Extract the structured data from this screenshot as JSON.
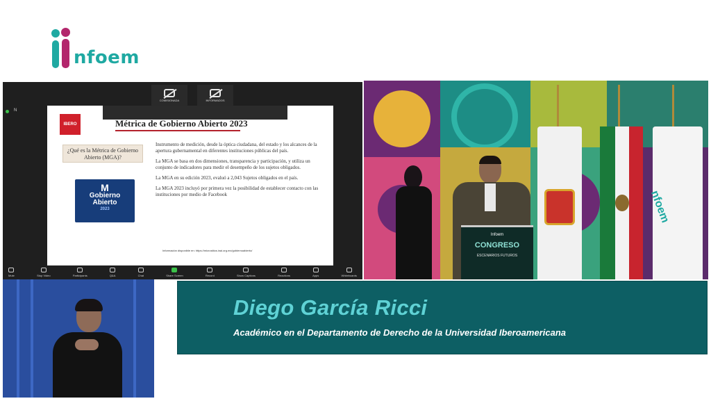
{
  "logo": {
    "text": "nfoem"
  },
  "zoom": {
    "camera_tiles": [
      "COMISIONADA",
      "INFORMADOS"
    ],
    "participant_label": "N",
    "slide": {
      "logo_text": "IBERO",
      "title": "Métrica de Gobierno Abierto 2023",
      "question": "¿Qué es la Métrica de Gobierno Abierto (MGA)?",
      "mga_logo": {
        "line1": "M",
        "line2": "Gobierno",
        "line3": "Abierto",
        "year": "2023"
      },
      "paragraphs": [
        "Instrumento de medición, desde la óptica ciudadana, del estado y los alcances de la apertura gubernamental en diferentes instituciones públicas del país.",
        "La MGA se basa en dos dimensiones, transparencia y participación, y utiliza un conjunto de indicadores para medir el desempeño de los sujetos obligados.",
        "La MGA en su edición 2023, evaluó a 2,043 Sujetos obligados en el país.",
        "La MGA 2023 incluyó por primera vez la posibilidad de establecer contacto con las instituciones por medio de Facebook"
      ],
      "footer": "Información disponible en: https://micrositios.inai.org.mx/gobiernoabierto/"
    },
    "toolbar": [
      "Mute",
      "Stop Video",
      "Participants",
      "Q&A",
      "Chat",
      "Share Screen",
      "Record",
      "Show Captions",
      "Reactions",
      "Apps",
      "Whiteboards"
    ]
  },
  "stage": {
    "podium": {
      "brand": "Infoem",
      "title": "CONGRESO",
      "subtitle": "ESCENARIOS FUTUROS"
    },
    "banner_logo": "nfoem"
  },
  "banner": {
    "name": "Diego García Ricci",
    "role": "Académico en el Departamento de Derecho de la Universidad Iberoamericana"
  },
  "colors": {
    "teal": "#1fa9a2",
    "magenta": "#b3266c",
    "banner": "#0d5f64",
    "name": "#5fd2d5"
  }
}
